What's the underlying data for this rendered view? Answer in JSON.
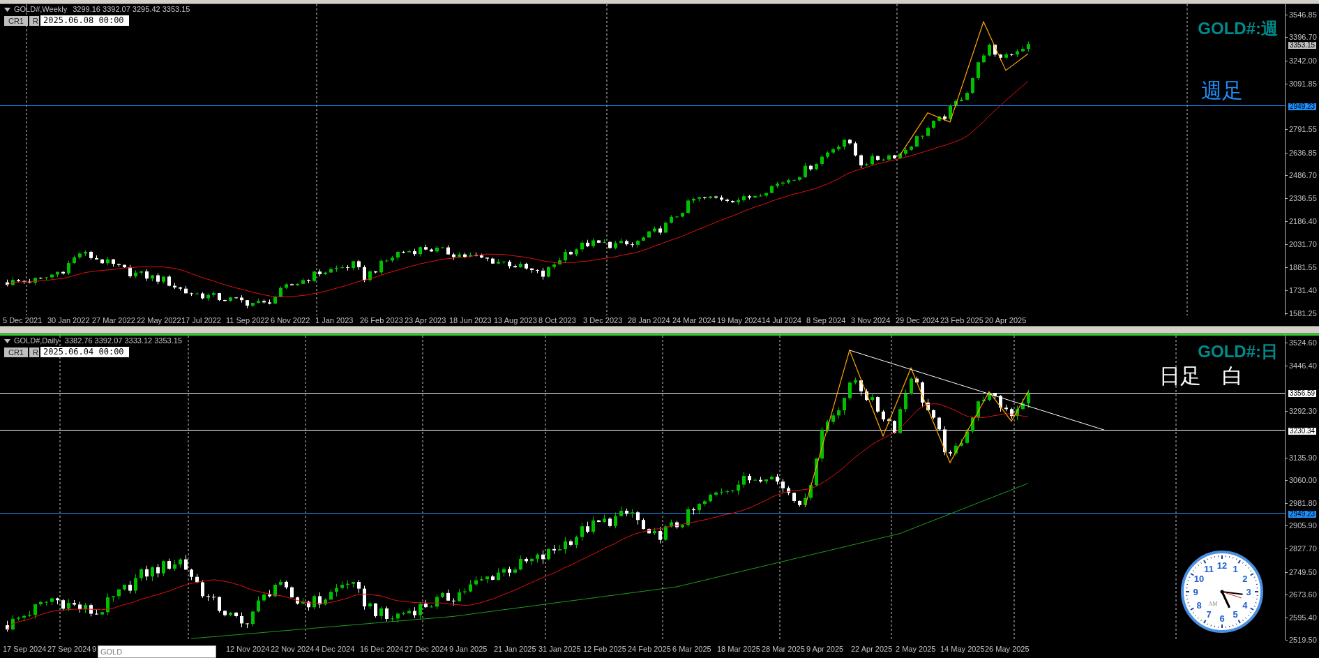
{
  "weekly": {
    "symbol": "GOLD#,Weekly",
    "ohlc": "3299.16 3392.07 3295.42 3353.15",
    "buttons": [
      "CR1",
      "R"
    ],
    "date_field": "2025.06.08 00:00",
    "title": "GOLD#:週",
    "note": "週足",
    "price_axis": [
      "3546.85",
      "3396.70",
      "3242.00",
      "3091.85",
      "2791.55",
      "2636.85",
      "2486.70",
      "2336.55",
      "2186.40",
      "2031.70",
      "1881.55",
      "1731.40",
      "1581.25"
    ],
    "price_tags": [
      {
        "text": "3353.15",
        "kind": "current"
      },
      {
        "text": "2949.23",
        "kind": "blue_line"
      }
    ],
    "date_axis": [
      "5 Dec 2021",
      "30 Jan 2022",
      "27 Mar 2022",
      "22 May 2022",
      "17 Jul 2022",
      "11 Sep 2022",
      "6 Nov 2022",
      "1 Jan 2023",
      "26 Feb 2023",
      "23 Apr 2023",
      "18 Jun 2023",
      "13 Aug 2023",
      "8 Oct 2023",
      "3 Dec 2023",
      "28 Jan 2024",
      "24 Mar 2024",
      "19 May 2024",
      "14 Jul 2024",
      "8 Sep 2024",
      "3 Nov 2024",
      "29 Dec 2024",
      "23 Feb 2025",
      "20 Apr 2025"
    ]
  },
  "daily": {
    "symbol": "GOLD#,Daily",
    "ohlc": "3382.76 3392.07 3333.12 3353.15",
    "buttons": [
      "CR1",
      "R"
    ],
    "date_field": "2025.06.04 00:00",
    "title": "GOLD#:日",
    "note": "日足　白",
    "price_axis": [
      "3524.60",
      "3446.40",
      "3292.30",
      "3135.90",
      "3060.00",
      "2981.80",
      "2905.90",
      "2827.70",
      "2749.50",
      "2673.60",
      "2595.40",
      "2519.50"
    ],
    "price_tags": [
      {
        "text": "3356.59",
        "kind": "white_line"
      },
      {
        "text": "3230.34",
        "kind": "white_line"
      },
      {
        "text": "2949.23",
        "kind": "blue_line"
      }
    ],
    "date_axis": [
      "17 Sep 2024",
      "27 Sep 2024",
      "9",
      "12 Nov 2024",
      "22 Nov 2024",
      "4 Dec 2024",
      "16 Dec 2024",
      "27 Dec 2024",
      "9 Jan 2025",
      "21 Jan 2025",
      "31 Jan 2025",
      "12 Feb 2025",
      "24 Feb 2025",
      "6 Mar 2025",
      "18 Mar 2025",
      "28 Mar 2025",
      "9 Apr 2025",
      "22 Apr 2025",
      "2 May 2025",
      "14 May 2025",
      "26 May 2025"
    ],
    "symbol_field": "GOLD"
  },
  "clock": {
    "numerals": [
      "12",
      "11",
      "1",
      "10",
      "2",
      "9",
      "3",
      "8",
      "4",
      "7",
      "5",
      "6"
    ],
    "period": "AM"
  }
}
